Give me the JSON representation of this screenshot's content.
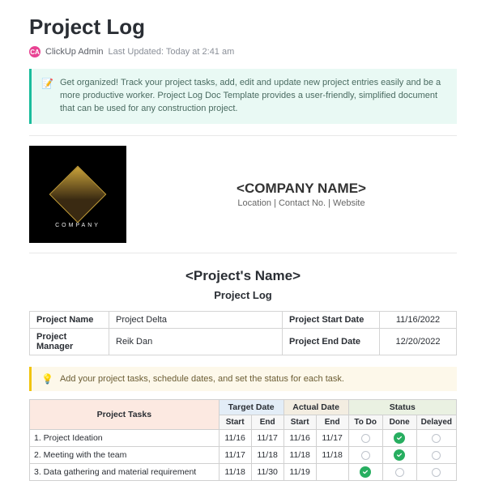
{
  "title": "Project Log",
  "author": {
    "initials": "CA",
    "name": "ClickUp Admin"
  },
  "last_updated_label": "Last Updated: Today at 2:41 am",
  "green_banner": {
    "icon": "📝",
    "text": "Get organized! Track your project tasks, add, edit and update new project entries easily and be a more productive worker. Project Log Doc Template provides a user-friendly, simplified document that can be used for any construction project."
  },
  "company": {
    "logo_label": "COMPANY",
    "name_placeholder": "<COMPANY NAME>",
    "subline": "Location | Contact No. | Website"
  },
  "project_header": {
    "name_placeholder": "<Project's Name>",
    "subtitle": "Project Log"
  },
  "meta": {
    "project_name_label": "Project Name",
    "project_name_value": "Project Delta",
    "project_manager_label": "Project Manager",
    "project_manager_value": "Reik Dan",
    "start_date_label": "Project Start Date",
    "start_date_value": "11/16/2022",
    "end_date_label": "Project End Date",
    "end_date_value": "12/20/2022"
  },
  "yellow_banner": {
    "icon": "💡",
    "text": "Add your project tasks, schedule dates, and set the status for each task."
  },
  "task_table": {
    "headers": {
      "tasks": "Project Tasks",
      "target": "Target Date",
      "actual": "Actual Date",
      "status": "Status",
      "start": "Start",
      "end": "End",
      "todo": "To Do",
      "done": "Done",
      "delayed": "Delayed"
    },
    "rows": [
      {
        "task": "1. Project Ideation",
        "t_start": "11/16",
        "t_end": "11/17",
        "a_start": "11/16",
        "a_end": "11/17",
        "status": "done"
      },
      {
        "task": "2. Meeting with the team",
        "t_start": "11/17",
        "t_end": "11/18",
        "a_start": "11/18",
        "a_end": "11/18",
        "status": "done"
      },
      {
        "task": "3. Data gathering and material requirement",
        "t_start": "11/18",
        "t_end": "11/30",
        "a_start": "11/19",
        "a_end": "",
        "status": "todo"
      }
    ]
  }
}
